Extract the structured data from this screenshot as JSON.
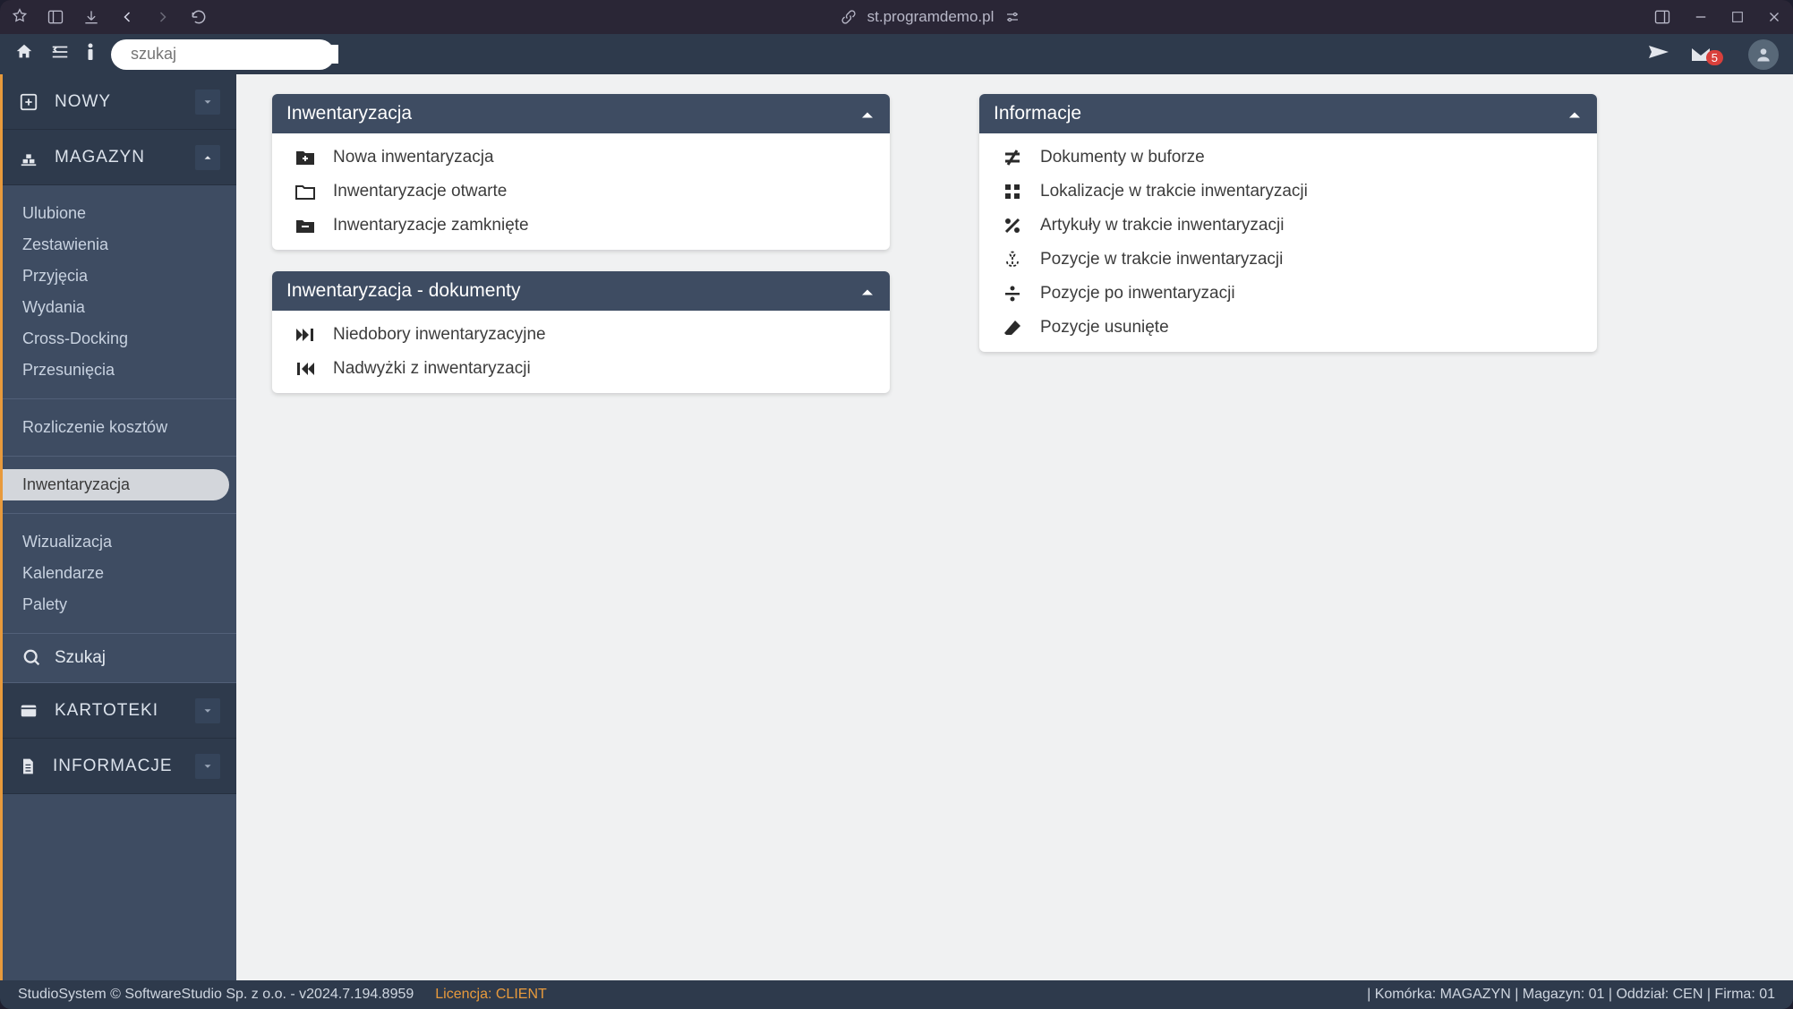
{
  "titlebar": {
    "url": "st.programdemo.pl"
  },
  "topbar": {
    "search_placeholder": "szukaj",
    "mail_badge": "5"
  },
  "sidebar": {
    "sections": {
      "nowy": {
        "label": "NOWY"
      },
      "magazyn": {
        "label": "MAGAZYN"
      },
      "kartoteki": {
        "label": "KARTOTEKI"
      },
      "informacje": {
        "label": "INFORMACJE"
      }
    },
    "magazyn_items": {
      "ulubione": "Ulubione",
      "zestawienia": "Zestawienia",
      "przyjecia": "Przyjęcia",
      "wydania": "Wydania",
      "cross": "Cross-Docking",
      "przesuniecia": "Przesunięcia",
      "rozliczenie": "Rozliczenie kosztów",
      "inwentaryzacja": "Inwentaryzacja",
      "wizualizacja": "Wizualizacja",
      "kalendarze": "Kalendarze",
      "palety": "Palety",
      "szukaj": "Szukaj"
    }
  },
  "panels": {
    "inwentaryzacja": {
      "title": "Inwentaryzacja",
      "items": {
        "nowa": "Nowa inwentaryzacja",
        "otwarte": "Inwentaryzacje otwarte",
        "zamkniete": "Inwentaryzacje zamknięte"
      }
    },
    "dokumenty": {
      "title": "Inwentaryzacja - dokumenty",
      "items": {
        "niedobory": "Niedobory inwentaryzacyjne",
        "nadwyzki": "Nadwyżki z inwentaryzacji"
      }
    },
    "informacje": {
      "title": "Informacje",
      "items": {
        "bufor": "Dokumenty w buforze",
        "lokalizacje": "Lokalizacje w trakcie inwentaryzacji",
        "artykuly": "Artykuły w trakcie inwentaryzacji",
        "pozycje_trakcie": "Pozycje w trakcie inwentaryzacji",
        "pozycje_po": "Pozycje po inwentaryzacji",
        "pozycje_usuniete": "Pozycje usunięte"
      }
    }
  },
  "statusbar": {
    "system": "StudioSystem © SoftwareStudio Sp. z o.o. - v2024.7.194.8959",
    "license_label": "Licencja: ",
    "license_value": "CLIENT",
    "right": "| Komórka: MAGAZYN | Magazyn: 01 | Oddział: CEN | Firma: 01"
  }
}
